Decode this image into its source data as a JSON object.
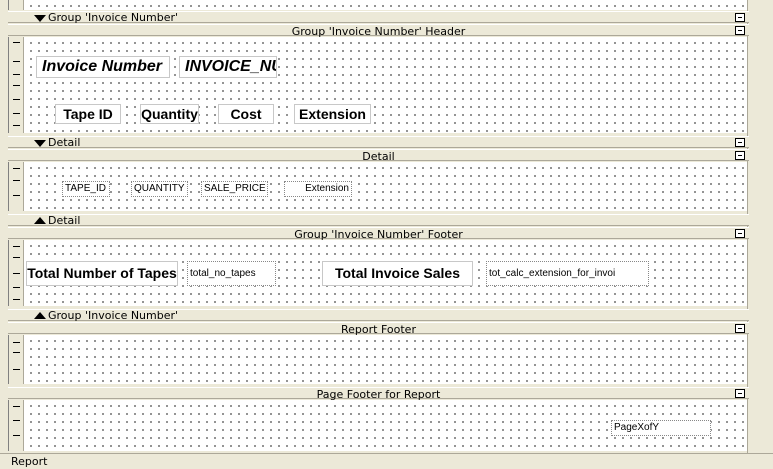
{
  "groups": {
    "invoice_number_top": "Group 'Invoice Number'",
    "detail_top": "Detail",
    "detail_bottom": "Detail",
    "invoice_number_bottom": "Group 'Invoice Number'"
  },
  "sections": {
    "group_header": "Group 'Invoice Number' Header",
    "detail": "Detail",
    "group_footer": "Group 'Invoice Number' Footer",
    "report_footer": "Report Footer",
    "page_footer": "Page Footer for Report"
  },
  "header_controls": {
    "invoice_number_label": "Invoice Number",
    "invoice_number_field": "INVOICE_NU",
    "tape_id_label": "Tape ID",
    "quantity_label": "Quantity",
    "cost_label": "Cost",
    "extension_label": "Extension"
  },
  "detail_controls": {
    "tape_id": "TAPE_ID",
    "quantity": "QUANTITY",
    "sale_price": "SALE_PRICE",
    "extension": "Extension"
  },
  "footer_controls": {
    "total_tapes_label": "Total Number of Tapes",
    "total_tapes_field": "total_no_tapes",
    "total_sales_label": "Total Invoice Sales",
    "total_sales_field": "tot_calc_extension_for_invoi"
  },
  "page_footer_controls": {
    "page_x_of_y": "PageXofY"
  },
  "status": {
    "label": "Report"
  }
}
